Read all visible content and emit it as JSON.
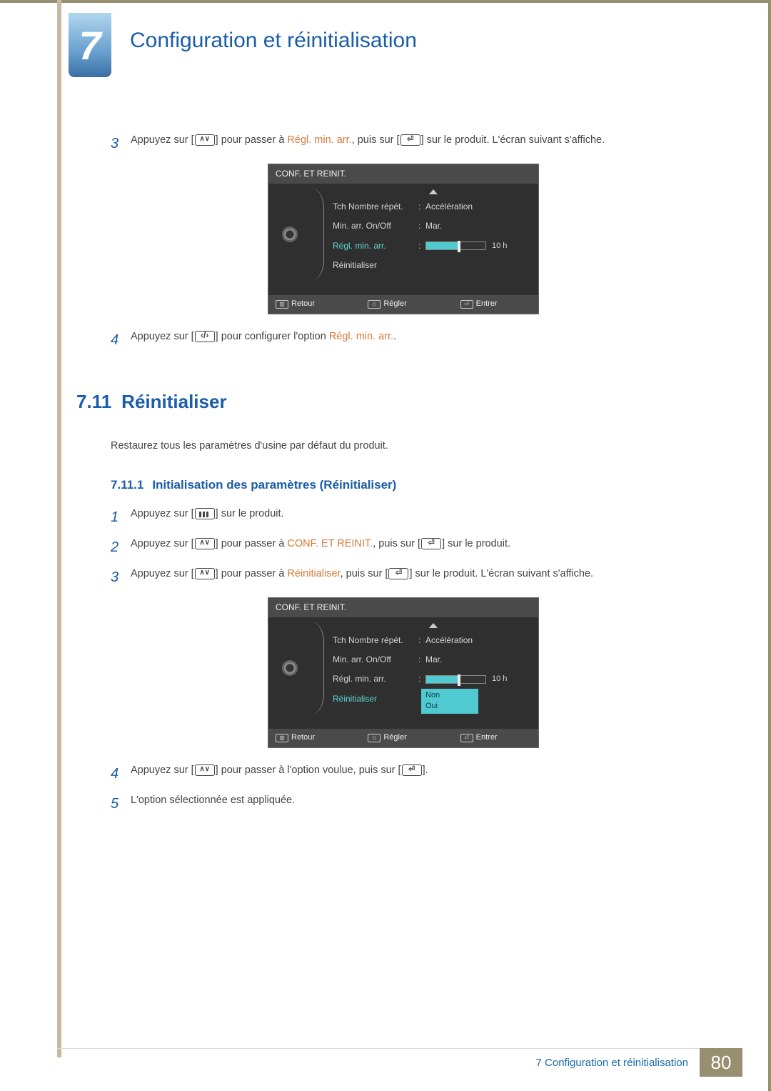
{
  "chapter": {
    "number": "7",
    "title": "Configuration et réinitialisation"
  },
  "body": {
    "step3": {
      "num": "3",
      "t1": "Appuyez sur [",
      "t2": "] pour passer à ",
      "hl": "Régl. min. arr.",
      "t3": ", puis sur [",
      "t4": "] sur le produit. L'écran suivant s'affiche."
    },
    "step4": {
      "num": "4",
      "t1": "Appuyez sur [",
      "t2": "] pour configurer l'option ",
      "hl": "Régl. min. arr.",
      "t3": "."
    }
  },
  "osd1": {
    "title": "CONF. ET REINIT.",
    "rows": [
      {
        "label": "Tch Nombre répét.",
        "value": "Accélération"
      },
      {
        "label": "Min. arr. On/Off",
        "value": "Mar."
      },
      {
        "label": "Régl. min. arr.",
        "slider": "10 h",
        "active": true
      },
      {
        "label": "Réinitialiser",
        "value": ""
      }
    ],
    "footer": {
      "back": "Retour",
      "adjust": "Régler",
      "enter": "Entrer"
    }
  },
  "section711": {
    "num": "7.11",
    "title": "Réinitialiser",
    "desc": "Restaurez tous les paramètres d'usine par défaut du produit."
  },
  "sub7111": {
    "num": "7.11.1",
    "title": "Initialisation des paramètres (Réinitialiser)"
  },
  "steps2": {
    "s1": {
      "num": "1",
      "t1": "Appuyez sur [",
      "t2": "] sur le produit."
    },
    "s2": {
      "num": "2",
      "t1": "Appuyez sur [",
      "t2": "] pour passer à ",
      "hl": "CONF. ET REINIT.",
      "t3": ", puis sur [",
      "t4": "] sur le produit."
    },
    "s3": {
      "num": "3",
      "t1": "Appuyez sur [",
      "t2": "] pour passer à ",
      "hl": "Réinitialiser",
      "t3": ", puis sur [",
      "t4": "] sur le produit. L'écran suivant s'affiche."
    },
    "s4": {
      "num": "4",
      "t1": "Appuyez sur [",
      "t2": "] pour passer à l'option voulue, puis sur [",
      "t3": "]."
    },
    "s5": {
      "num": "5",
      "t1": "L'option sélectionnée est appliquée."
    }
  },
  "osd2": {
    "title": "CONF. ET REINIT.",
    "rows": [
      {
        "label": "Tch Nombre répét.",
        "value": "Accélération"
      },
      {
        "label": "Min. arr. On/Off",
        "value": "Mar."
      },
      {
        "label": "Régl. min. arr.",
        "slider": "10 h"
      },
      {
        "label": "Réinitialiser",
        "value": "",
        "active": true
      }
    ],
    "popup": {
      "opt1": "Non",
      "opt2": "Oui"
    },
    "footer": {
      "back": "Retour",
      "adjust": "Régler",
      "enter": "Entrer"
    }
  },
  "footer": {
    "label": "7 Configuration et réinitialisation",
    "page": "80"
  }
}
